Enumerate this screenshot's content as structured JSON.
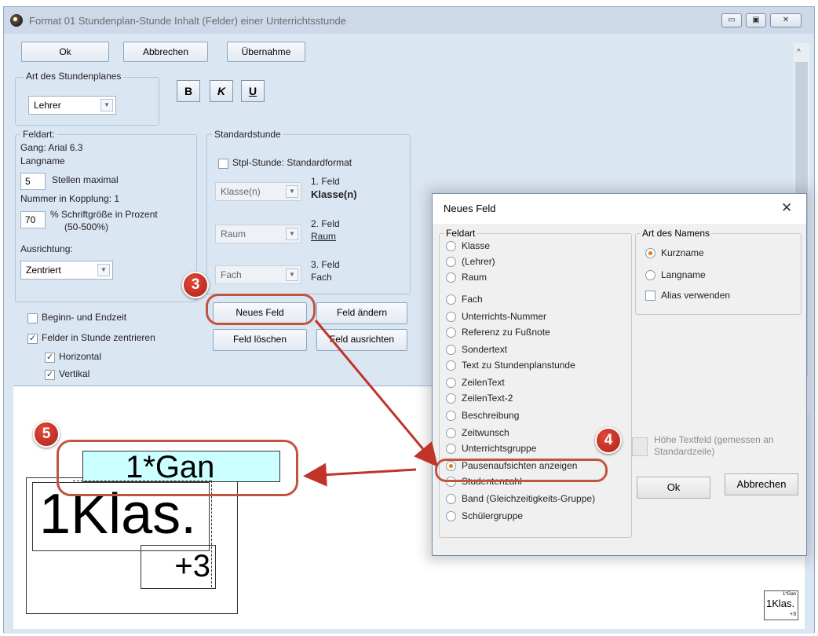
{
  "window": {
    "title": "Format 01  Stundenplan-Stunde  Inhalt (Felder) einer Unterrichtsstunde",
    "minimize": "▭",
    "maximize": "▣",
    "close": "✕"
  },
  "toolbar": {
    "ok": "Ok",
    "cancel": "Abbrechen",
    "apply": "Übernahme"
  },
  "plan_type": {
    "legend": "Art des Stundenplanes",
    "value": "Lehrer"
  },
  "format_buttons": {
    "bold": "B",
    "italic": "K",
    "underline": "U"
  },
  "field_type": {
    "legend": "Feldart:",
    "field_name": "Gang: Arial 6.3",
    "name_type": "Langname",
    "max_digits_value": "5",
    "max_digits_label": "Stellen maximal",
    "coupling": "Nummer in Kopplung: 1",
    "font_size_value": "70",
    "font_size_label": "% Schriftgröße in Prozent",
    "font_size_range": "(50-500%)",
    "alignment_label": "Ausrichtung:",
    "alignment_value": "Zentriert"
  },
  "standard": {
    "legend": "Standardstunde",
    "checkbox_label": "Stpl-Stunde: Standardformat",
    "fields": [
      {
        "combo": "Klasse(n)",
        "num": "1. Feld",
        "name": "Klasse(n)"
      },
      {
        "combo": "Raum",
        "num": "2. Feld",
        "name": "Raum"
      },
      {
        "combo": "Fach",
        "num": "3. Feld",
        "name": "Fach"
      }
    ]
  },
  "actions": {
    "new_field": "Neues Feld",
    "change_field": "Feld ändern",
    "delete_field": "Feld löschen",
    "align_field": "Feld ausrichten"
  },
  "options": {
    "begin_end": "Beginn- und Endzeit",
    "center": "Felder in Stunde zentrieren",
    "horizontal": "Horizontal",
    "vertical": "Vertikal"
  },
  "preview": {
    "field_gan": "1*Gan",
    "field_klas": "1Klas.",
    "field_plus": "+3",
    "thumb_top": "1*Gan",
    "thumb_mid": "1Klas.",
    "thumb_bottom": "+3"
  },
  "dialog": {
    "title": "Neues Feld",
    "close": "✕",
    "feldart_legend": "Feldart",
    "options": [
      "Klasse",
      "(Lehrer)",
      "Raum",
      "Fach",
      "Unterrichts-Nummer",
      "Referenz zu Fußnote",
      "Sondertext",
      "Text zu Stundenplanstunde",
      "ZeilenText",
      "ZeilenText-2",
      "Beschreibung",
      "Zeitwunsch",
      "Unterrichtsgruppe",
      "Pausenaufsichten anzeigen",
      "Studentenzahl",
      "Band (Gleichzeitigkeits-Gruppe)",
      "Schülergruppe"
    ],
    "selected_index": 13,
    "name_legend": "Art des Namens",
    "short_name": "Kurzname",
    "long_name": "Langname",
    "alias": "Alias verwenden",
    "height_label": "Höhe Textfeld (gemessen an Standardzeile)",
    "ok": "Ok",
    "cancel": "Abbrechen"
  },
  "badges": {
    "b3": "3",
    "b4": "4",
    "b5": "5"
  },
  "colors": {
    "accent_red": "#c0553f",
    "arrow": "#c0342a",
    "gan_fill": "#ccffff",
    "selected_radio": "#e07b1a"
  }
}
